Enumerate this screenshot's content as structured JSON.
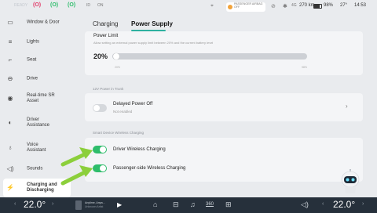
{
  "status": {
    "ready": "READY",
    "indicators": [
      "(O)",
      "(O)",
      "(O)"
    ],
    "small_icons": [
      "ID",
      "ON"
    ],
    "pill_text": "PASSENGER AIRBAG OFF",
    "distance": "270 km",
    "battery": "98%",
    "outside_temp": "27°",
    "time": "14:53"
  },
  "sidebar": {
    "items": [
      {
        "label": "Window & Door"
      },
      {
        "label": "Lights"
      },
      {
        "label": "Seat"
      },
      {
        "label": "Drive"
      },
      {
        "label": "Real-time SR Asset"
      },
      {
        "label": "Driver Assistance"
      },
      {
        "label": "Voice Assistant"
      },
      {
        "label": "Sounds"
      },
      {
        "label": "Charging and Discharging"
      }
    ]
  },
  "tabs": [
    {
      "label": "Charging"
    },
    {
      "label": "Power Supply"
    }
  ],
  "power_limit": {
    "title": "Power Limit",
    "description": "Allow setting an external power supply limit between 20% and the current battery level",
    "value_text": "20%",
    "value": 20,
    "min_label": "20%",
    "max_label": "98%"
  },
  "trunk": {
    "section": "12V Power in Trunk",
    "delayed_title": "Delayed Power Off",
    "delayed_status": "Not enabled",
    "delayed_on": false
  },
  "wireless": {
    "section": "Smart Device Wireless Charging",
    "driver_label": "Driver Wireless Charging",
    "driver_on": true,
    "passenger_label": "Passenger-side Wireless Charging",
    "passenger_on": true
  },
  "bottom": {
    "left_temp": "22.0°",
    "right_temp": "22.0°",
    "song": "Anytime, Anyw...",
    "artist": "Unknown Artist",
    "dock_360": "360"
  },
  "colors": {
    "accent": "#2fb1a0",
    "toggle_on": "#2ebd6b",
    "arrow": "#8ccf3b",
    "bottom_bar": "#26303b"
  }
}
